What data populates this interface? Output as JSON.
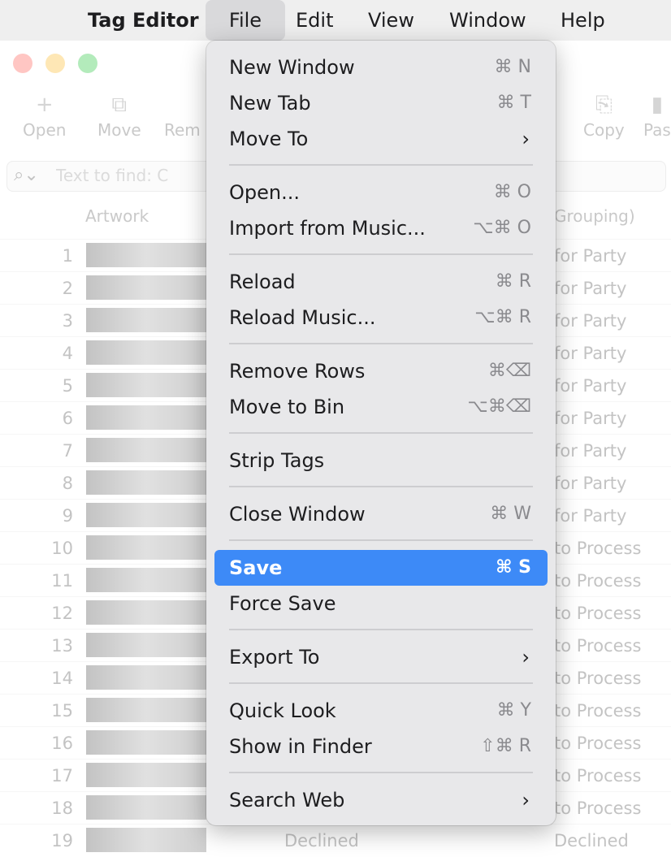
{
  "menubar": {
    "apple_glyph": "",
    "app_name": "Tag Editor",
    "items": [
      "File",
      "Edit",
      "View",
      "Window",
      "Help"
    ]
  },
  "toolbar": {
    "open": "Open",
    "move": "Move",
    "remove": "Rem",
    "copy": "Copy",
    "paste": "Pas"
  },
  "search": {
    "placeholder": "Text to find: C"
  },
  "columns": {
    "artwork": "Artwork",
    "grouping": "Grouping)"
  },
  "rows": [
    {
      "num": "1",
      "grouping": "for Party"
    },
    {
      "num": "2",
      "grouping": "for Party"
    },
    {
      "num": "3",
      "grouping": "for Party"
    },
    {
      "num": "4",
      "grouping": "for Party"
    },
    {
      "num": "5",
      "grouping": "for Party"
    },
    {
      "num": "6",
      "grouping": "for Party"
    },
    {
      "num": "7",
      "grouping": "for Party"
    },
    {
      "num": "8",
      "grouping": "for Party"
    },
    {
      "num": "9",
      "grouping": "for Party"
    },
    {
      "num": "10",
      "grouping": "to Process"
    },
    {
      "num": "11",
      "grouping": "to Process"
    },
    {
      "num": "12",
      "grouping": "to Process"
    },
    {
      "num": "13",
      "grouping": "to Process"
    },
    {
      "num": "14",
      "grouping": "to Process"
    },
    {
      "num": "15",
      "grouping": "to Process"
    },
    {
      "num": "16",
      "grouping": "to Process"
    },
    {
      "num": "17",
      "grouping": "to Process"
    },
    {
      "num": "18",
      "grouping": "to Process"
    },
    {
      "num": "19",
      "grouping": "Declined",
      "status": "Declined"
    }
  ],
  "file_menu": {
    "new_window": {
      "label": "New Window",
      "shortcut": "⌘ N"
    },
    "new_tab": {
      "label": "New Tab",
      "shortcut": "⌘ T"
    },
    "move_to": {
      "label": "Move To",
      "submenu": "›"
    },
    "open": {
      "label": "Open...",
      "shortcut": "⌘ O"
    },
    "import_music": {
      "label": "Import from Music...",
      "shortcut": "⌥⌘ O"
    },
    "reload": {
      "label": "Reload",
      "shortcut": "⌘ R"
    },
    "reload_music": {
      "label": "Reload Music...",
      "shortcut": "⌥⌘ R"
    },
    "remove_rows": {
      "label": "Remove Rows",
      "shortcut": "⌘⌫"
    },
    "move_to_bin": {
      "label": "Move to Bin",
      "shortcut": "⌥⌘⌫"
    },
    "strip_tags": {
      "label": "Strip Tags"
    },
    "close_window": {
      "label": "Close Window",
      "shortcut": "⌘ W"
    },
    "save": {
      "label": "Save",
      "shortcut": "⌘ S"
    },
    "force_save": {
      "label": "Force Save"
    },
    "export_to": {
      "label": "Export To",
      "submenu": "›"
    },
    "quick_look": {
      "label": "Quick Look",
      "shortcut": "⌘ Y"
    },
    "show_in_finder": {
      "label": "Show in Finder",
      "shortcut": "⇧⌘ R"
    },
    "search_web": {
      "label": "Search Web",
      "submenu": "›"
    }
  },
  "colors": {
    "highlight": "#3d8af7"
  }
}
